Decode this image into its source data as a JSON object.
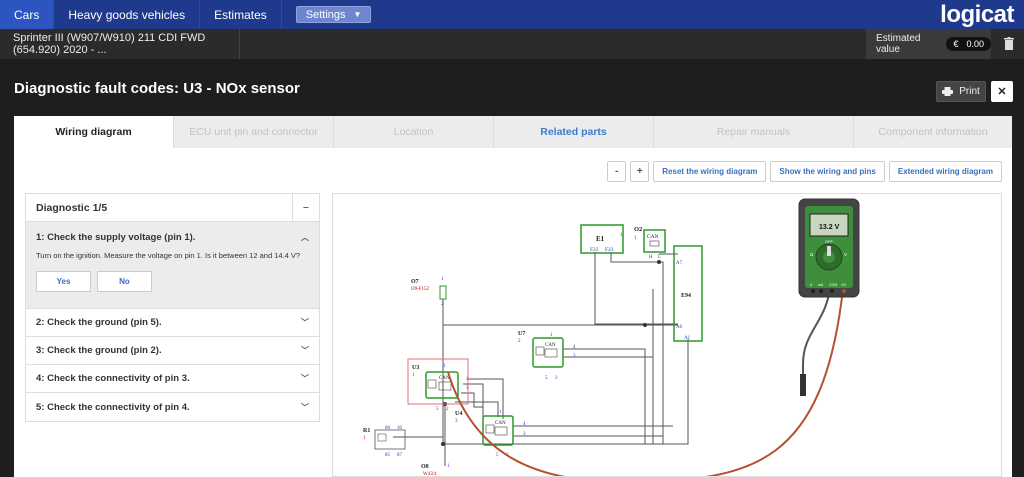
{
  "nav": {
    "tabs": [
      "Cars",
      "Heavy goods vehicles",
      "Estimates"
    ],
    "settings_label": "Settings",
    "logo": "logicat"
  },
  "vehicle": {
    "name": "Sprinter III (W907/W910) 211 CDI FWD (654.920) 2020 - ...",
    "estimated_label": "Estimated value",
    "currency": "€",
    "amount": "0.00"
  },
  "page": {
    "title": "Diagnostic fault codes: U3 - NOx sensor",
    "print_label": "Print",
    "close_label": "✕"
  },
  "tabs": [
    {
      "label": "Wiring diagram"
    },
    {
      "label": "ECU unit pin and connector"
    },
    {
      "label": "Location"
    },
    {
      "label": "Related parts"
    },
    {
      "label": "Repair manuals"
    },
    {
      "label": "Component information"
    }
  ],
  "controls": {
    "minus": "-",
    "plus": "+",
    "reset": "Reset the wiring diagram",
    "show": "Show the wiring and pins",
    "extended": "Extended wiring diagram"
  },
  "diagnostic": {
    "header": "Diagnostic 1/5",
    "collapse": "−",
    "open_step": {
      "title": "1: Check the supply voltage (pin 1).",
      "description": "Turn on the ignition. Measure the voltage on pin 1. Is it between 12 and 14.4 V?",
      "yes": "Yes",
      "no": "No"
    },
    "steps": [
      "2: Check the ground (pin 5).",
      "3: Check the ground (pin 2).",
      "4: Check the connectivity of pin 3.",
      "5: Check the connectivity of pin 4."
    ]
  },
  "wiring": {
    "components": {
      "E1": "E1",
      "E1_a": "1",
      "E1_pin1": "F22",
      "E1_pin2": "F23",
      "O2": "O2",
      "O2_a": "1",
      "O2_can": "CAN",
      "O2_h": "H",
      "O2_l": "L",
      "E94": "E94",
      "E94_a7": "A7",
      "E94_a6": "A6",
      "E94_a1": "A1",
      "O7": "O7",
      "O7_sub": "O9-F152",
      "O7_p1": "1",
      "O7_p2": "2",
      "U7": "U7",
      "U7_a": "2",
      "U7_can": "CAN",
      "U7_p1": "1",
      "U7_p4": "4",
      "U7_p3": "3",
      "U7_p5": "5",
      "U7_p2": "2",
      "U3": "U3",
      "U3_a": "1",
      "U3_can": "CAN",
      "U3_p1": "1",
      "U3_p4": "4",
      "U3_p3": "3",
      "U3_p5": "5",
      "U3_p2": "2",
      "U4": "U4",
      "U4_a": "3",
      "U4_can": "CAN",
      "U4_p1": "1",
      "U4_p4": "4",
      "U4_p3": "3",
      "U4_p5": "5",
      "U4_p2": "2",
      "R1": "R1",
      "R1_a": "1",
      "R1_86": "86",
      "R1_30": "30",
      "R1_85": "85",
      "R1_87": "87",
      "O8": "O8",
      "O8_sub": "W43/4",
      "O8_p1": "1"
    },
    "multimeter": {
      "reading": "13.2 V",
      "com": "COM",
      "vohm": "VΩ",
      "a": "A",
      "ma": "mA",
      "v_label": "V",
      "off_label": "OFF",
      "ohm_label": "Ω"
    }
  },
  "colors": {
    "nav_bg": "#1f3a8c",
    "accent": "#3a6fc0",
    "component_green": "#2a9a2a",
    "probe_red": "#b5512f",
    "meter_green": "#3e8e3c"
  }
}
